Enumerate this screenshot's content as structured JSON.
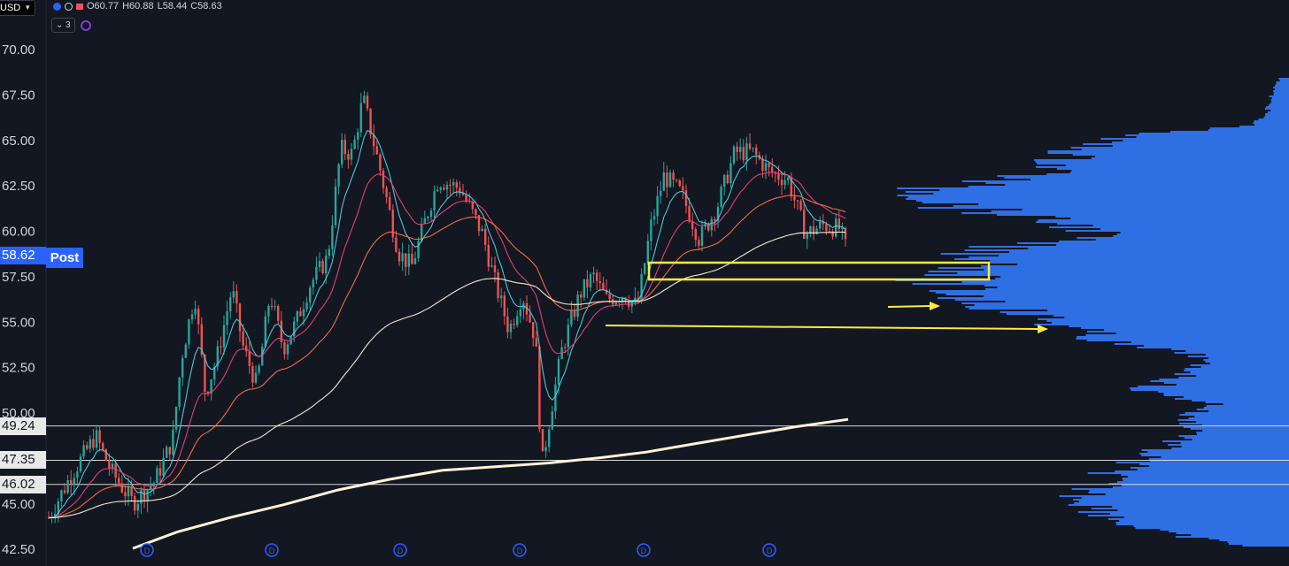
{
  "header": {
    "symbol_fragment": "USD",
    "ohlc": {
      "o": "O60.77",
      "h": "H60.88",
      "l": "L58.44",
      "c": "C58.63"
    },
    "indicator_count": "3"
  },
  "axis": {
    "y_ticks": [
      "70.00",
      "67.50",
      "65.00",
      "62.50",
      "60.00",
      "57.50",
      "55.00",
      "52.50",
      "50.00",
      "45.00",
      "42.50"
    ],
    "price_tags": [
      {
        "label": "58.62",
        "style": "blue",
        "price": 58.62
      },
      {
        "label": "49.24",
        "style": "white",
        "price": 49.24
      },
      {
        "label": "47.35",
        "style": "white",
        "price": 47.35
      },
      {
        "label": "46.02",
        "style": "white",
        "price": 46.02
      }
    ],
    "session_label": "Post",
    "dividend_marker": "D"
  },
  "colors": {
    "background": "#131722",
    "up": "#26a69a",
    "down": "#ef5350",
    "ema_fast": "#4dd0e1",
    "ema_mid": "#ec407a",
    "ema_slow": "#ff7043",
    "ma_long": "#fff3d6",
    "volume_profile": "#2f6fe4",
    "annotation": "#ffeb3b",
    "session_tag": "#2962ff"
  }
}
